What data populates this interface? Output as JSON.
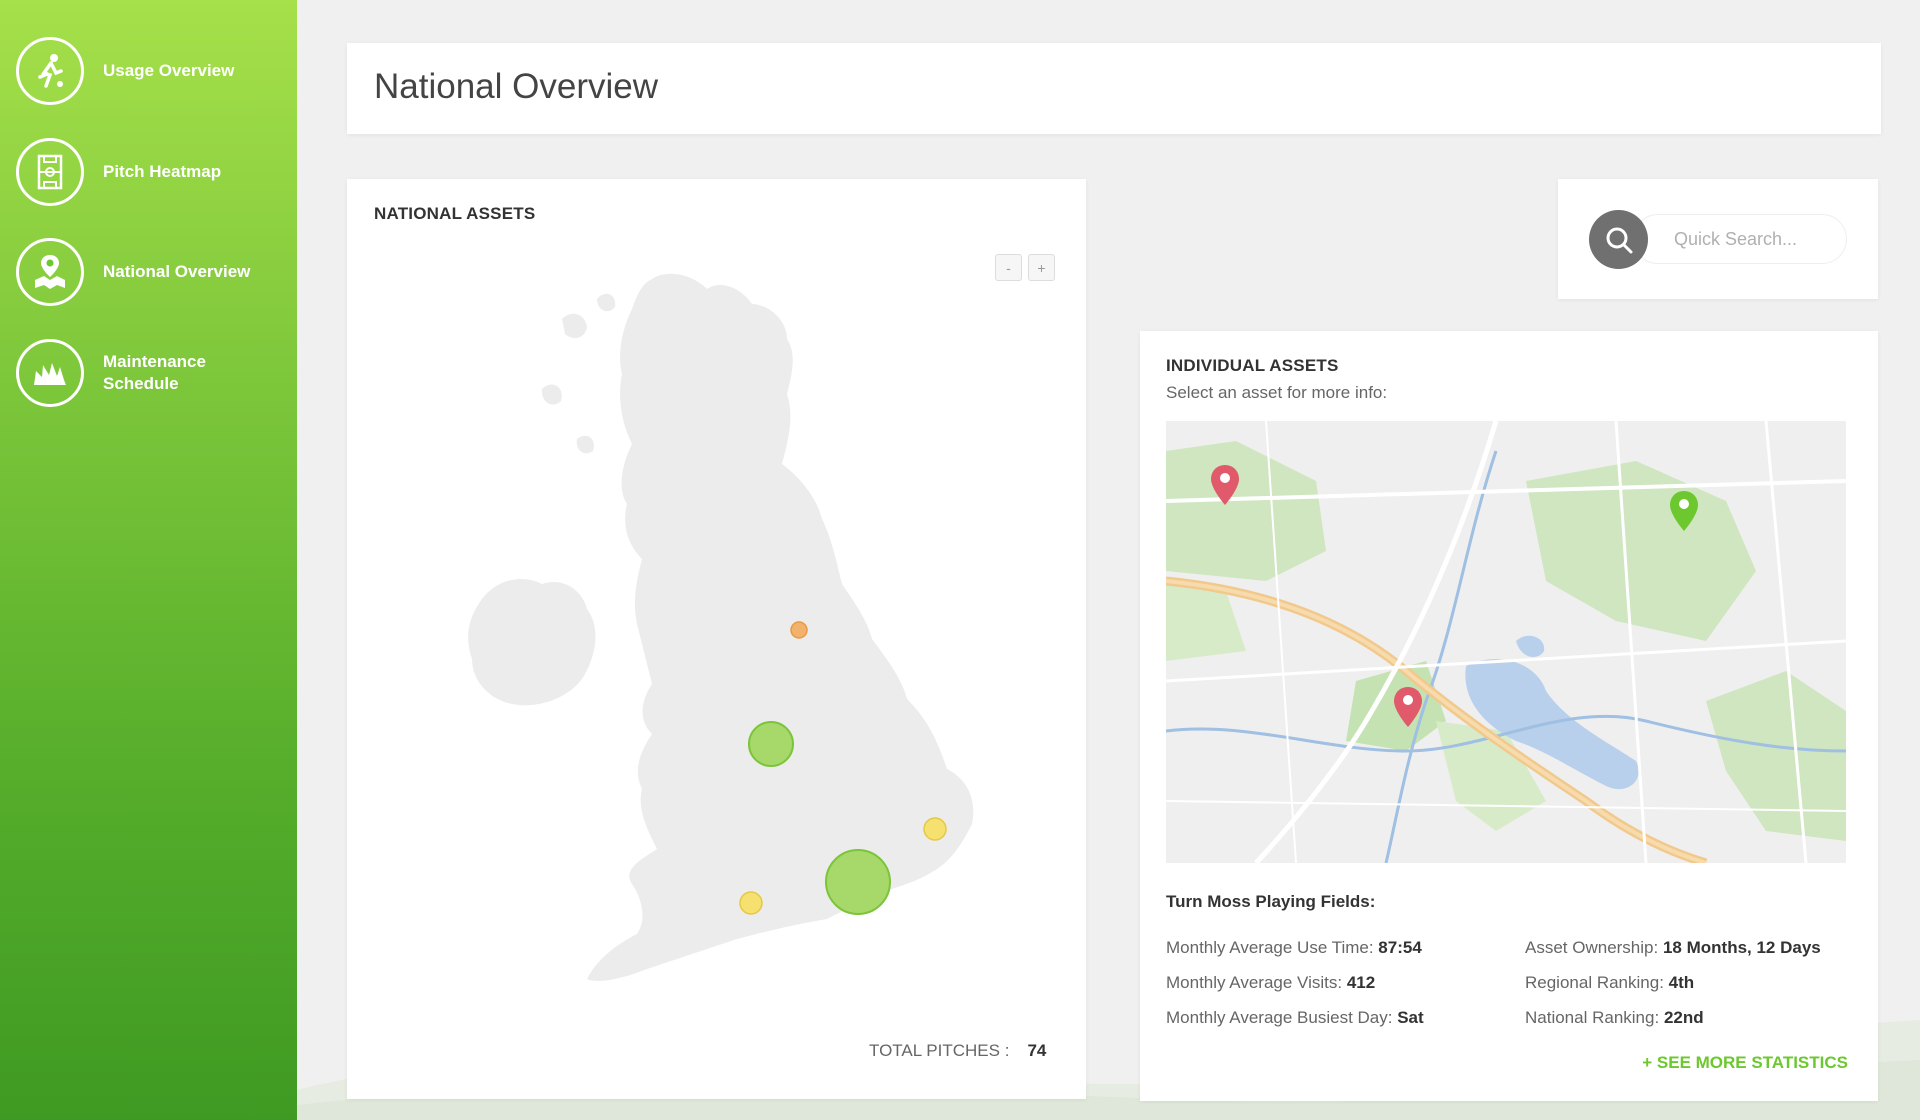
{
  "sidebar": {
    "items": [
      {
        "label": "Usage Overview",
        "icon": "player-icon"
      },
      {
        "label": "Pitch Heatmap",
        "icon": "pitch-icon"
      },
      {
        "label": "National Overview",
        "icon": "map-pin-icon"
      },
      {
        "label": "Maintenance Schedule",
        "icon": "grass-icon"
      }
    ]
  },
  "header": {
    "title": "National Overview"
  },
  "national_assets": {
    "title": "NATIONAL ASSETS",
    "zoom_out": "-",
    "zoom_in": "+",
    "total_label": "TOTAL PITCHES :",
    "total_value": "74"
  },
  "search": {
    "placeholder": "Quick Search..."
  },
  "individual_assets": {
    "title": "INDIVIDUAL ASSETS",
    "subtitle": "Select an asset for more info:",
    "field_name": "Turn Moss Playing Fields:",
    "stats_left": [
      {
        "label": "Monthly Average Use Time:",
        "value": "87:54"
      },
      {
        "label": "Monthly Average Visits:",
        "value": "412"
      },
      {
        "label": "Monthly Average Busiest Day:",
        "value": "Sat"
      }
    ],
    "stats_right": [
      {
        "label": "Asset Ownership:",
        "value": "18 Months, 12 Days"
      },
      {
        "label": "Regional Ranking:",
        "value": "4th"
      },
      {
        "label": "National Ranking:",
        "value": "22nd"
      }
    ],
    "see_more": "+ SEE MORE STATISTICS"
  },
  "colors": {
    "accent": "#6cc82e",
    "marker_red": "#e05a6b",
    "marker_green": "#6cc82e",
    "bubble_green": "#a6d96a",
    "bubble_orange": "#f2b26b",
    "bubble_yellow": "#f5e070"
  }
}
